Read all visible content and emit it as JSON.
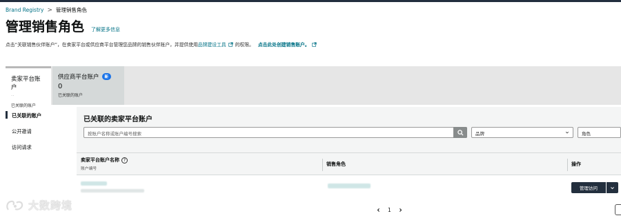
{
  "breadcrumb": {
    "root": "Brand Registry",
    "separator": ">",
    "current": "管理销售角色"
  },
  "header": {
    "title": "管理销售角色",
    "learn_more": "了解更多信息"
  },
  "description": {
    "part1": "点击“关联销售伙伴账户”，在卖家平台或供应商平台管理您品牌的销售伙伴账户，并提供使用",
    "link1": "品牌建设工具",
    "part2": "的权限。",
    "link2": "点击此处创建销售账户。"
  },
  "tabs": [
    {
      "label": "卖家平台账户",
      "count": "··",
      "sub": "已关联的账户",
      "badge": ""
    },
    {
      "label": "供应商平台账户",
      "count": "0",
      "sub": "已关联的账户",
      "badge": "新"
    }
  ],
  "sidebar": {
    "items": [
      "已关联的账户",
      "公开邀请",
      "访问请求"
    ]
  },
  "panel": {
    "title": "已关联的卖家平台账户",
    "search_placeholder": "按账户名称或账户编号搜索",
    "brand_select": "品牌",
    "role_select": "角色"
  },
  "table": {
    "col_name": "卖家平台账户名称",
    "col_name_sub": "账户编号",
    "col_role": "销售角色",
    "col_action": "操作",
    "manage_label": "管理访问"
  },
  "pagination": {
    "page": "1"
  },
  "watermark": {
    "text": "大数跨境"
  },
  "colors": {
    "accent": "#007185",
    "nav_dark": "#232f3e",
    "badge": "#1a73e8"
  }
}
